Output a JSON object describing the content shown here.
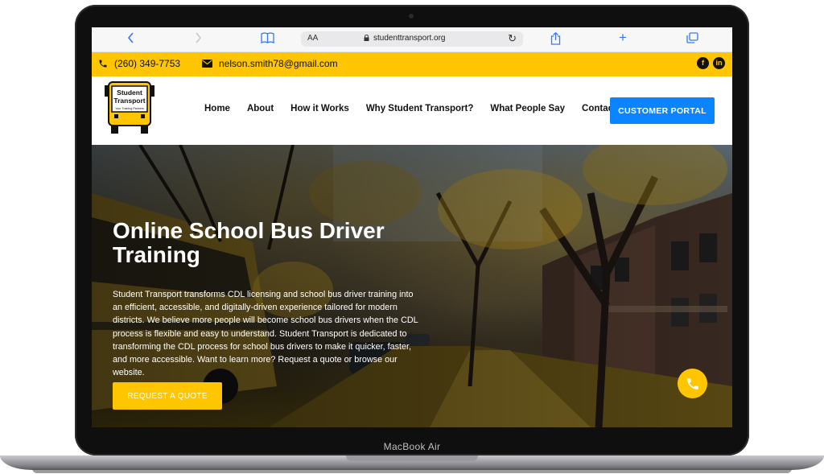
{
  "device": {
    "label": "MacBook Air"
  },
  "browser": {
    "url": "studenttransport.org",
    "text_size_label": "AA",
    "icons": [
      "chevron-left-icon",
      "chevron-right-icon",
      "book-icon",
      "lock-icon",
      "reload-icon",
      "share-icon",
      "plus-icon",
      "tabs-icon"
    ]
  },
  "topbar": {
    "phone": "(260) 349-7753",
    "email": "nelson.smith78@gmail.com",
    "social": [
      "facebook-icon",
      "linkedin-icon"
    ]
  },
  "logo": {
    "line1": "Student",
    "line2": "Transport",
    "tagline": "Your Training Partners"
  },
  "nav": {
    "items": [
      {
        "label": "Home"
      },
      {
        "label": "About"
      },
      {
        "label": "How it Works"
      },
      {
        "label": "Why Student Transport?"
      },
      {
        "label": "What People Say"
      },
      {
        "label": "Contact"
      }
    ],
    "portal_label": "CUSTOMER PORTAL"
  },
  "hero": {
    "title": "Online School Bus Driver Training",
    "body": "Student Transport transforms CDL licensing and school bus driver training into an efficient, accessible, and digitally-driven experience tailored for modern districts. We believe more people will become school bus drivers when the CDL process is flexible and easy to understand.  Student Transport is dedicated to transforming the CDL process for school bus drivers to make it quicker, faster, and more accessible.  Want to learn more?  Request a quote or browse our website.",
    "cta_label": "REQUEST A QUOTE"
  },
  "colors": {
    "accent_yellow": "#ffc600",
    "portal_blue": "#0a84ff",
    "browser_blue": "#3478f6"
  }
}
